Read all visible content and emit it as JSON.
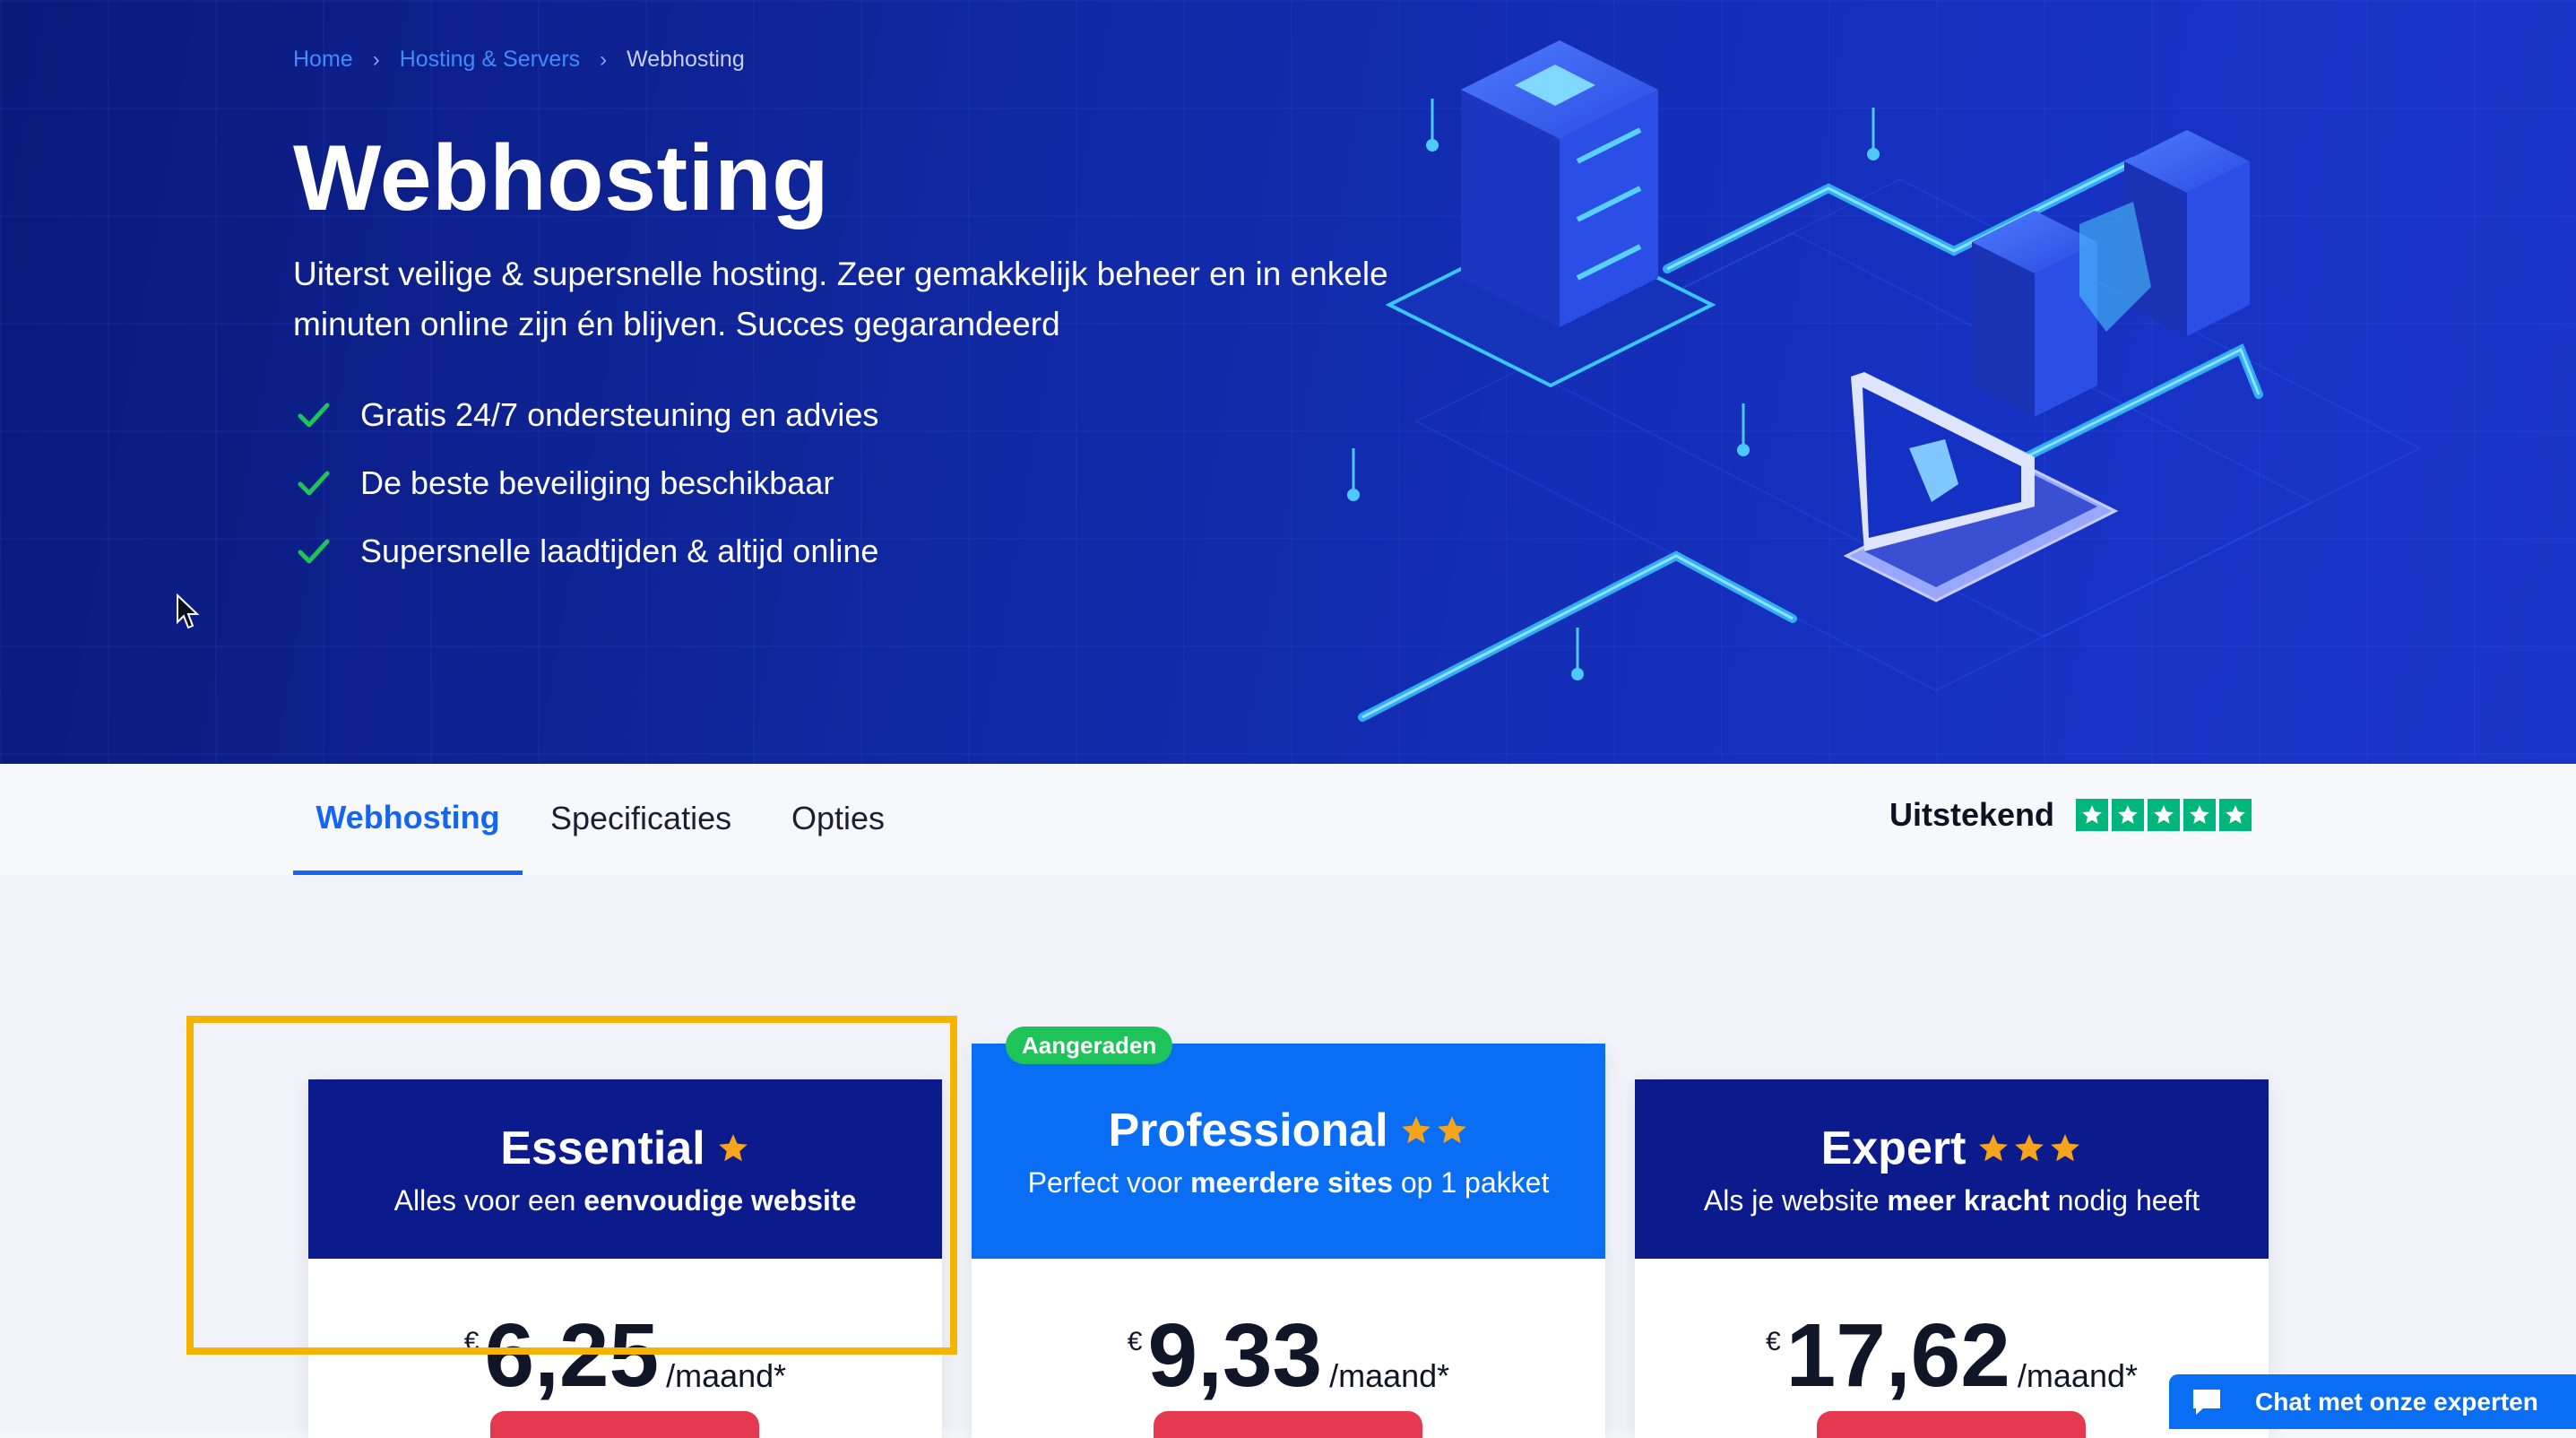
{
  "breadcrumb": {
    "home": "Home",
    "category": "Hosting & Servers",
    "current": "Webhosting",
    "separator": "›"
  },
  "hero": {
    "title": "Webhosting",
    "subtitle": "Uiterst veilige & supersnelle hosting. Zeer gemakkelijk beheer en in enkele minuten online zijn én blijven. Succes gegarandeerd",
    "features": [
      "Gratis 24/7 ondersteuning en advies",
      "De beste beveiliging beschikbaar",
      "Supersnelle laadtijden & altijd online"
    ]
  },
  "tabs": {
    "webhosting": "Webhosting",
    "specificaties": "Specificaties",
    "opties": "Opties"
  },
  "rating": {
    "label": "Uitstekend",
    "stars": 5
  },
  "plans": {
    "badge": "Aangeraden",
    "essential": {
      "name": "Essential",
      "desc_prefix": "Alles voor een ",
      "desc_bold": "eenvoudige website",
      "desc_suffix": "",
      "currency": "€",
      "price": "6,25",
      "period": "/maand*",
      "stars": 1
    },
    "professional": {
      "name": "Professional",
      "desc_prefix": "Perfect voor ",
      "desc_bold": "meerdere sites",
      "desc_suffix": " op 1 pakket",
      "currency": "€",
      "price": "9,33",
      "period": "/maand*",
      "stars": 2
    },
    "expert": {
      "name": "Expert",
      "desc_prefix": "Als je website ",
      "desc_bold": "meer kracht",
      "desc_suffix": " nodig heeft",
      "currency": "€",
      "price": "17,62",
      "period": "/maand*",
      "stars": 3
    }
  },
  "chat": {
    "label": "Chat met onze experten"
  },
  "colors": {
    "hero_bg": "#112aa8",
    "accent_blue": "#1466f0",
    "plan_dark": "#0c1b8c",
    "plan_highlight": "#0a6ef5",
    "check_green": "#1ec35a",
    "star_orange": "#f7a41d",
    "trustpilot_green": "#00b67a",
    "highlight_frame": "#f5b400"
  },
  "icons": [
    "check-icon",
    "chevron-right-icon",
    "star-icon",
    "chat-bubble-icon",
    "mouse-cursor-icon"
  ]
}
